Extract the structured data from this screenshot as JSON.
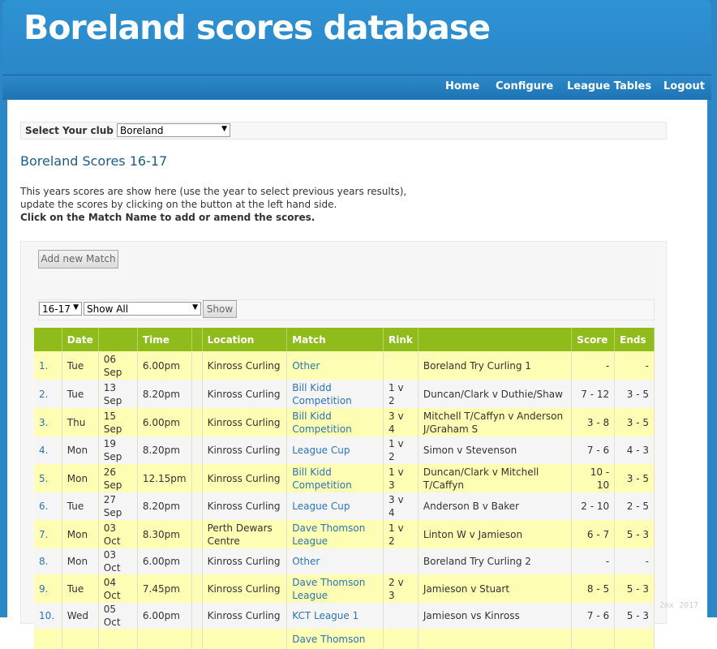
{
  "header": {
    "title": "Boreland scores database"
  },
  "nav": [
    "Home",
    "Configure",
    "League Tables",
    "Logout"
  ],
  "club": {
    "label": "Select Your club :",
    "selected": "Boreland"
  },
  "page": {
    "heading": "Boreland Scores 16-17",
    "intro_line1": "This years scores are show here (use the year to select previous years results),",
    "intro_line2": "update the scores by clicking on the button at the left hand side.",
    "intro_bold": "Click on the Match Name to add or amend the scores."
  },
  "buttons": {
    "add_match": "Add new Match",
    "show": "Show"
  },
  "filters": {
    "year": "16-17",
    "type": "Show All"
  },
  "table": {
    "headers": [
      "",
      "Date",
      "",
      "Time",
      "",
      "Location",
      "Match",
      "Rink",
      "",
      "Score",
      "Ends"
    ],
    "rows": [
      {
        "num": "1.",
        "day": "Tue",
        "date": "06 Sep",
        "time": "6.00pm",
        "location": "Kinross Curling",
        "match": "Other",
        "rink": "",
        "teams": "Boreland Try Curling 1",
        "score": "-",
        "ends": "-"
      },
      {
        "num": "2.",
        "day": "Tue",
        "date": "13 Sep",
        "time": "8.20pm",
        "location": "Kinross Curling",
        "match": "Bill Kidd Competition",
        "rink": "1 v 2",
        "teams": "Duncan/Clark v Duthie/Shaw",
        "score": "7 - 12",
        "ends": "3 - 5"
      },
      {
        "num": "3.",
        "day": "Thu",
        "date": "15 Sep",
        "time": "6.00pm",
        "location": "Kinross Curling",
        "match": "Bill Kidd Competition",
        "rink": "3 v 4",
        "teams": "Mitchell T/Caffyn v Anderson J/Graham S",
        "score": "3 - 8",
        "ends": "3 - 5"
      },
      {
        "num": "4.",
        "day": "Mon",
        "date": "19 Sep",
        "time": "8.20pm",
        "location": "Kinross Curling",
        "match": "League Cup",
        "rink": "1 v 2",
        "teams": "Simon v Stevenson",
        "score": "7 - 6",
        "ends": "4 - 3"
      },
      {
        "num": "5.",
        "day": "Mon",
        "date": "26 Sep",
        "time": "12.15pm",
        "location": "Kinross Curling",
        "match": "Bill Kidd Competition",
        "rink": "1 v 3",
        "teams": "Duncan/Clark v Mitchell T/Caffyn",
        "score": "10 - 10",
        "ends": "3 - 5"
      },
      {
        "num": "6.",
        "day": "Tue",
        "date": "27 Sep",
        "time": "8.20pm",
        "location": "Kinross Curling",
        "match": "League Cup",
        "rink": "3 v 4",
        "teams": "Anderson B v Baker",
        "score": "2 - 10",
        "ends": "2 - 5"
      },
      {
        "num": "7.",
        "day": "Mon",
        "date": "03 Oct",
        "time": "8.30pm",
        "location": "Perth Dewars Centre",
        "match": "Dave Thomson League",
        "rink": "1 v 2",
        "teams": "Linton W v Jamieson",
        "score": "6 - 7",
        "ends": "5 - 3"
      },
      {
        "num": "8.",
        "day": "Mon",
        "date": "03 Oct",
        "time": "6.00pm",
        "location": "Kinross Curling",
        "match": "Other",
        "rink": "",
        "teams": "Boreland Try Curling 2",
        "score": "-",
        "ends": "-"
      },
      {
        "num": "9.",
        "day": "Tue",
        "date": "04 Oct",
        "time": "7.45pm",
        "location": "Kinross Curling",
        "match": "Dave Thomson League",
        "rink": "2 v 3",
        "teams": "Jamieson v Stuart",
        "score": "8 - 5",
        "ends": "5 - 3"
      },
      {
        "num": "10.",
        "day": "Wed",
        "date": "05 Oct",
        "time": "6.00pm",
        "location": "Kinross Curling",
        "match": "KCT League 1",
        "rink": "",
        "teams": "Jamieson vs Kinross",
        "score": "7 - 6",
        "ends": "5 - 3"
      },
      {
        "num": "",
        "day": "",
        "date": "",
        "time": "",
        "location": "",
        "match": "Dave Thomson",
        "rink": "",
        "teams": "",
        "score": "",
        "ends": ""
      }
    ]
  },
  "watermark": "2mx  2017"
}
